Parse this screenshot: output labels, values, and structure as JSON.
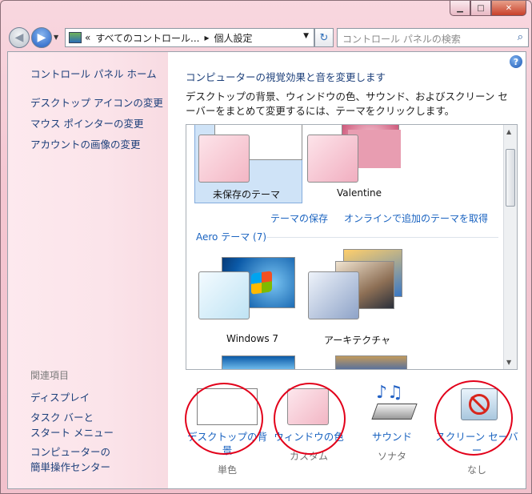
{
  "window": {
    "caption": {
      "minimize": "▁",
      "maximize": "□",
      "close": "✕"
    }
  },
  "nav": {
    "back_icon": "◀",
    "forward_icon": "▶",
    "history_dropdown": "▼",
    "breadcrumb_overflow": "«",
    "breadcrumb_1": "すべてのコントロール...",
    "breadcrumb_sep": "▸",
    "breadcrumb_2": "個人設定",
    "address_dropdown": "▼",
    "refresh_icon": "↻",
    "search_placeholder": "コントロール パネルの検索",
    "search_icon": "⌕"
  },
  "sidebar": {
    "home": "コントロール パネル ホーム",
    "links": [
      "デスクトップ アイコンの変更",
      "マウス ポインターの変更",
      "アカウントの画像の変更"
    ],
    "related_heading": "関連項目",
    "related": [
      {
        "line1": "ディスプレイ"
      },
      {
        "line1": "タスク バーと",
        "line2": "スタート メニュー"
      },
      {
        "line1": "コンピューターの",
        "line2": "簡単操作センター"
      }
    ]
  },
  "main": {
    "help_icon": "?",
    "title": "コンピューターの視覚効果と音を変更します",
    "description": "デスクトップの背景、ウィンドウの色、サウンド、およびスクリーン セーバーをまとめて変更するには、テーマをクリックします。",
    "themes": {
      "unsaved_label": "未保存のテーマ",
      "valentine_label": "Valentine",
      "save_link": "テーマの保存",
      "online_link": "オンラインで追加のテーマを取得",
      "aero_heading": "Aero テーマ (7)",
      "windows7_label": "Windows 7",
      "architecture_label": "アーキテクチャ"
    },
    "options": [
      {
        "label": "デスクトップの背景",
        "sub": "単色"
      },
      {
        "label": "ウィンドウの色",
        "sub": "カスタム"
      },
      {
        "label": "サウンド",
        "sub": "ソナタ"
      },
      {
        "label": "スクリーン セーバー",
        "sub": "なし"
      }
    ]
  },
  "colors": {
    "accent_link": "#1a63c0",
    "annotation_circle": "#e2001a",
    "frame_pink": "#f4c6d1"
  }
}
